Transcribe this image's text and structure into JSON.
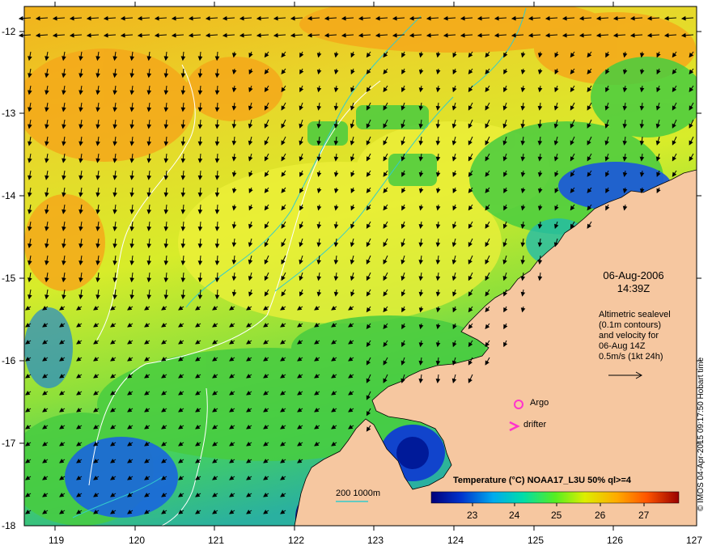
{
  "map": {
    "lon_ticks": [
      "119",
      "120",
      "121",
      "122",
      "123",
      "124",
      "125",
      "126",
      "127"
    ],
    "lat_ticks": [
      "-12",
      "-13",
      "-14",
      "-15",
      "-16",
      "-17",
      "-18"
    ],
    "lon_range": [
      118.6,
      127.0
    ],
    "lat_range": [
      -11.9,
      -18.0
    ]
  },
  "overlay": {
    "date": "06-Aug-2006",
    "time": "14:39Z",
    "legend_lines": [
      "Altimetric sealevel",
      "(0.1m contours)",
      "and velocity for",
      "06-Aug 14Z",
      "0.5m/s (1kt 24h)"
    ],
    "argo_label": "Argo",
    "drifter_label": "drifter",
    "scale_label": "200  1000m",
    "colorbar_title": "Temperature (°C) NOAA17_L3U 50% ql>=4",
    "colorbar_ticks": [
      "23",
      "24",
      "25",
      "26",
      "27"
    ],
    "credit": "© IMOS 04-Apr-2015 09:17:50 Hobart time"
  },
  "colors": {
    "land": "#f6c7a0",
    "contour_white": "#ffffff",
    "contour_cyan": "#33cccc",
    "argo_marker": "#ff33cc",
    "arrow": "#000000"
  }
}
